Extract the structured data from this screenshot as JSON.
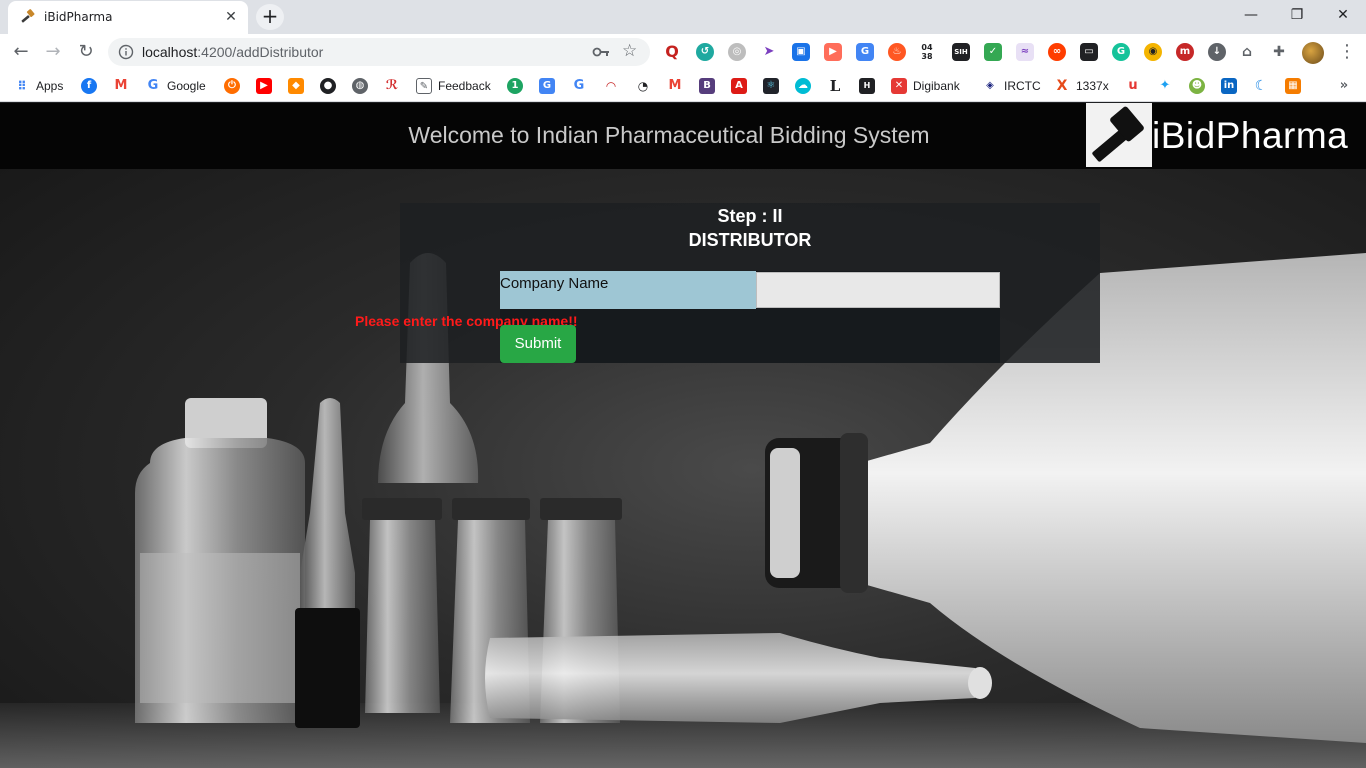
{
  "browser": {
    "tab_title": "iBidPharma",
    "url_host": "localhost",
    "url_path": ":4200/addDistributor",
    "bookmarks": {
      "apps": "Apps",
      "google": "Google",
      "feedback": "Feedback",
      "digibank": "Digibank",
      "irctc": "IRCTC",
      "x1337": "1337x"
    }
  },
  "header": {
    "title": "Welcome to Indian Pharmaceutical Bidding System",
    "logo_text": "iBidPharma"
  },
  "form": {
    "step": "Step : II",
    "heading": "DISTRIBUTOR",
    "company_label": "Company Name",
    "company_value": "",
    "error": "Please enter the company name!!",
    "submit_label": "Submit"
  },
  "colors": {
    "submit": "#28a745",
    "error": "#ff1a1a",
    "label_bg": "#9ec6d4"
  }
}
